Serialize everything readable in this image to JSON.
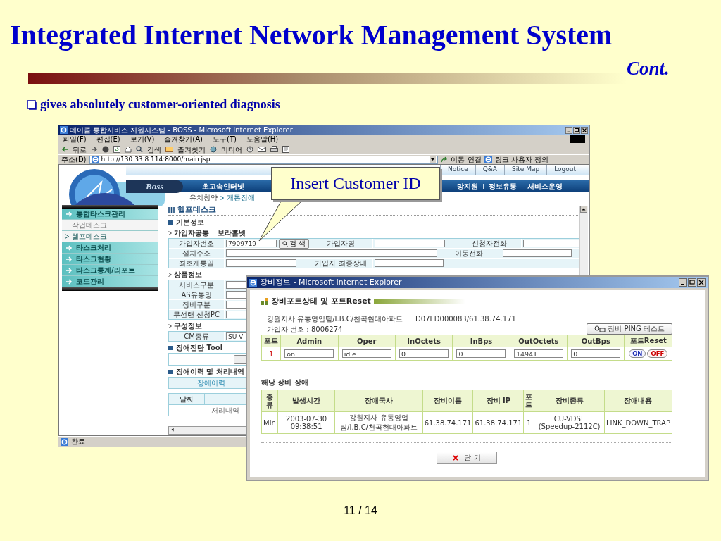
{
  "slide": {
    "title": "Integrated Internet Network Management System",
    "subtitle": "Cont.",
    "bullet": "gives absolutely customer-oriented diagnosis",
    "page": "11 / 14"
  },
  "browser": {
    "title": "데이콤 통합서비스 지원시스템 - BOSS - Microsoft Internet Explorer",
    "menu": [
      "파일(F)",
      "편집(E)",
      "보기(V)",
      "즐겨찾기(A)",
      "도구(T)",
      "도움말(H)"
    ],
    "toolbar": {
      "back": "뒤로",
      "search": "검색",
      "favorites": "즐겨찾기",
      "media": "미디어"
    },
    "address_label": "주소(D)",
    "address": "http://130.33.8.114:8000/main.jsp",
    "go": "이동",
    "links_label": "연결",
    "links": "링크 사용자 정의",
    "top_links": [
      "Notice",
      "Q&A",
      "Site Map",
      "Logout"
    ],
    "logo": "Boss",
    "menu_left": [
      "초고속인터넷"
    ],
    "menu_right": [
      "망지원",
      "정보유통",
      "서비스운영"
    ],
    "breadcrumb": [
      "유치청약",
      "개통장애"
    ],
    "sidebar": [
      {
        "kind": "header",
        "label": "통합타스크관리",
        "selected": false
      },
      {
        "kind": "sub",
        "label": "작업데스크",
        "selected": false
      },
      {
        "kind": "sub",
        "label": "헬프데스크",
        "selected": true
      },
      {
        "kind": "header",
        "label": "타스크처리",
        "selected": false
      },
      {
        "kind": "header",
        "label": "타스크현황",
        "selected": false
      },
      {
        "kind": "header",
        "label": "타스크통계/리포트",
        "selected": false
      },
      {
        "kind": "header",
        "label": "코드관리",
        "selected": false
      }
    ],
    "form": {
      "title": "헬프데스크",
      "blocks": [
        {
          "kind": "heading",
          "text": "기본정보"
        },
        {
          "kind": "group",
          "text": "가입자공통 _ 보라홈넷",
          "rows": [
            [
              {
                "kind": "label",
                "text": "가입자번호"
              },
              {
                "kind": "field",
                "value": "7909719",
                "button": "검 색"
              },
              {
                "kind": "label",
                "text": "가입자명"
              },
              {
                "kind": "field"
              },
              {
                "kind": "label",
                "text": "신청자전화"
              },
              {
                "kind": "field"
              }
            ],
            [
              {
                "kind": "label",
                "text": "설치주소"
              },
              {
                "kind": "wide_field"
              },
              "",
              "",
              {
                "kind": "label",
                "text": "이동전화"
              },
              {
                "kind": "field"
              }
            ],
            [
              {
                "kind": "label",
                "text": "최초개통일"
              },
              {
                "kind": "field"
              },
              {
                "kind": "label",
                "text": "가입자 최종상태"
              },
              {
                "kind": "field"
              }
            ]
          ]
        },
        {
          "kind": "group",
          "text": "상품정보",
          "rows": [
            [
              {
                "kind": "label",
                "text": "서비스구분"
              },
              {
                "kind": "field"
              }
            ],
            [
              {
                "kind": "label",
                "text": "AS유통망"
              },
              {
                "kind": "field"
              }
            ],
            [
              {
                "kind": "label",
                "text": "장비구분"
              },
              {
                "kind": "field"
              }
            ],
            [
              {
                "kind": "label",
                "text": "무선랜 신청PC"
              },
              {
                "kind": "field"
              }
            ]
          ]
        },
        {
          "kind": "group",
          "text": "구성정보",
          "rows": [
            [
              {
                "kind": "label",
                "text": "CM종류"
              },
              {
                "kind": "field",
                "value": "SU-V"
              }
            ]
          ]
        },
        {
          "kind": "heading",
          "text": "장애진단 Tool"
        },
        {
          "kind": "tool"
        },
        {
          "kind": "heading",
          "text": "장애이력 및 처리내역"
        },
        {
          "kind": "tab",
          "text": "장애이력"
        },
        {
          "kind": "history",
          "header": "날짜",
          "row": "처리내역"
        }
      ]
    },
    "status": "완료"
  },
  "callout": "Insert Customer ID",
  "popup": {
    "title": "장비정보 - Microsoft Internet Explorer",
    "heading": "장비포트상태 및 포트Reset",
    "info": [
      "강원지사 유통영업팀/I.B.C/천곡현대아파트",
      "D07ED000083/61.38.74.171"
    ],
    "subscriber": "가입자 번호 :  8006274",
    "ping": "장비 PING 테스트",
    "ports": {
      "columns": [
        "포트",
        "Admin",
        "Oper",
        "InOctets",
        "InBps",
        "OutOctets",
        "OutBps",
        "포트Reset"
      ],
      "rows": [
        {
          "port": "1",
          "values": [
            "on",
            "idle",
            "0",
            "0",
            "14941",
            "0"
          ],
          "buttons": [
            "ON",
            "OFF"
          ]
        }
      ]
    },
    "faults_title": "해당 장비 장애",
    "faults": {
      "columns": [
        "종류",
        "발생시간",
        "장애국사",
        "장비이름",
        "장비 IP",
        "포트",
        "장비종류",
        "장애내용"
      ],
      "rows": [
        [
          "Min",
          "2003-07-30 09:38:51",
          "강원지사 유통영업팀/I.B.C/천곡현대아파트",
          "61.38.74.171",
          "61.38.74.171",
          "1",
          "CU-VDSL (Speedup-2112C)",
          "LINK_DOWN_TRAP"
        ]
      ]
    },
    "close": "닫 기"
  }
}
